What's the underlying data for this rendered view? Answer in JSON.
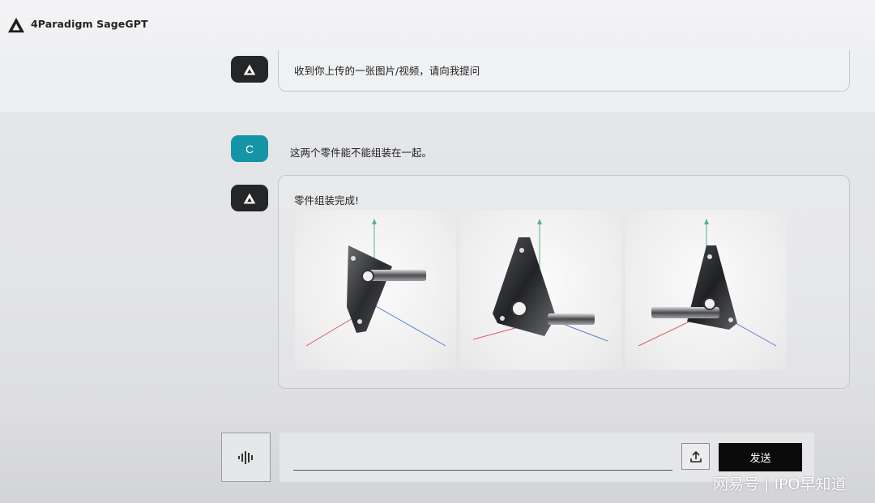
{
  "header": {
    "title": "4Paradigm SageGPT"
  },
  "conversation": {
    "previous_ai_message": "收到你上传的一张图片/视频，请向我提问",
    "user_avatar_letter": "C",
    "user_message": "这两个零件能不能组装在一起。",
    "ai_reply": "零件组装完成!",
    "result_images": [
      "assembled-part-view-1",
      "assembled-part-view-2",
      "assembled-part-view-3"
    ]
  },
  "input": {
    "value": "",
    "placeholder": "",
    "send_label": "发送"
  },
  "icons": [
    "logo-icon",
    "voice-icon",
    "upload-icon"
  ],
  "colors": {
    "user_avatar": "#1495a7",
    "ai_avatar": "#242628",
    "send_button": "#0b0b0b"
  },
  "watermark": "网易号 | IPO早知道"
}
